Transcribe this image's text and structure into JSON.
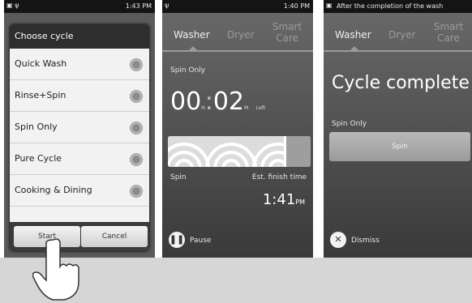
{
  "panel1": {
    "status_time": "1:43 PM",
    "dialog_title": "Choose cycle",
    "options": [
      "Quick Wash",
      "Rinse+Spin",
      "Spin Only",
      "Pure Cycle",
      "Cooking & Dining"
    ],
    "start_label": "Start",
    "cancel_label": "Cancel"
  },
  "panel2": {
    "status_time": "1:40 PM",
    "tabs": [
      "Washer",
      "Dryer",
      "Smart Care"
    ],
    "cycle": "Spin Only",
    "time_hours": "00",
    "time_minutes": "02",
    "time_h_unit": "H",
    "time_m_unit": "M",
    "time_left_label": "Left",
    "stage_label": "Spin",
    "est_label": "Est. finish time",
    "finish_time": "1:41",
    "finish_ampm": "PM",
    "pause_label": "Pause"
  },
  "panel3": {
    "notification": "After the completion of the wash",
    "tabs": [
      "Washer",
      "Dryer",
      "Smart Care"
    ],
    "headline": "Cycle complete",
    "cycle": "Spin Only",
    "stage": "Spin",
    "dismiss_label": "Dismiss"
  }
}
